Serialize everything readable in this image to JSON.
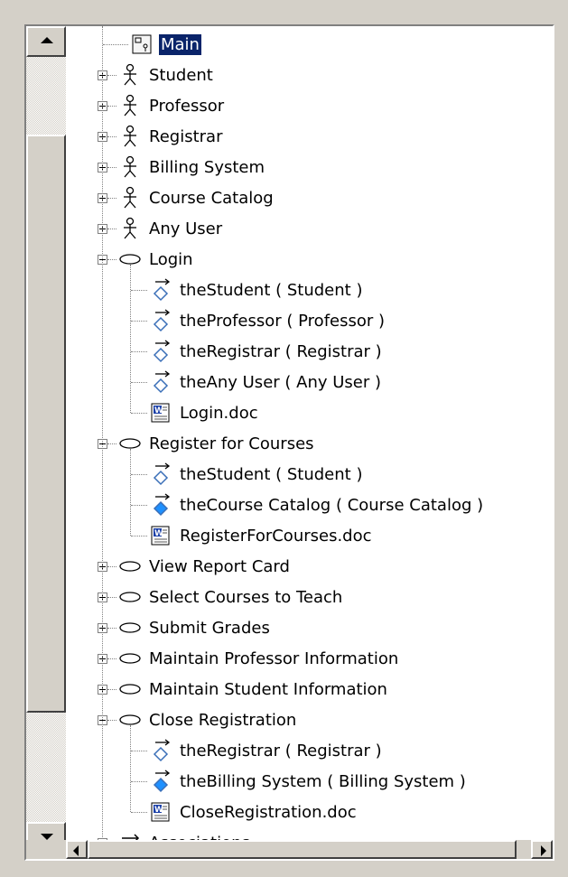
{
  "tree": {
    "root": {
      "label": "Main",
      "icon": "diagram-icon"
    },
    "actors": [
      {
        "label": "Student",
        "icon": "actor-icon"
      },
      {
        "label": "Professor",
        "icon": "actor-icon"
      },
      {
        "label": "Registrar",
        "icon": "actor-icon"
      },
      {
        "label": "Billing System",
        "icon": "actor-icon"
      },
      {
        "label": "Course Catalog",
        "icon": "actor-icon"
      },
      {
        "label": "Any User",
        "icon": "actor-icon"
      }
    ],
    "usecases": [
      {
        "label": "Login",
        "expanded": true,
        "children": [
          {
            "label": "theStudent ( Student )",
            "icon": "association-icon"
          },
          {
            "label": "theProfessor ( Professor )",
            "icon": "association-icon"
          },
          {
            "label": "theRegistrar ( Registrar )",
            "icon": "association-icon"
          },
          {
            "label": "theAny User ( Any User )",
            "icon": "association-icon"
          },
          {
            "label": "Login.doc",
            "icon": "document-icon"
          }
        ]
      },
      {
        "label": "Register for Courses",
        "expanded": true,
        "children": [
          {
            "label": "theStudent ( Student )",
            "icon": "association-icon"
          },
          {
            "label": "theCourse Catalog ( Course Catalog )",
            "icon": "association-filled-icon"
          },
          {
            "label": "RegisterForCourses.doc",
            "icon": "document-icon"
          }
        ]
      },
      {
        "label": "View Report Card",
        "expanded": false,
        "children": []
      },
      {
        "label": "Select Courses to Teach",
        "expanded": false,
        "children": []
      },
      {
        "label": "Submit Grades",
        "expanded": false,
        "children": []
      },
      {
        "label": "Maintain Professor Information",
        "expanded": false,
        "children": []
      },
      {
        "label": "Maintain Student Information",
        "expanded": false,
        "children": []
      },
      {
        "label": "Close Registration",
        "expanded": true,
        "children": [
          {
            "label": "theRegistrar ( Registrar )",
            "icon": "association-icon"
          },
          {
            "label": "theBilling System ( Billing System )",
            "icon": "association-filled-icon"
          },
          {
            "label": "CloseRegistration.doc",
            "icon": "document-icon"
          }
        ]
      }
    ],
    "associations": {
      "label": "Associations",
      "icon": "association-arrows-icon"
    }
  },
  "colors": {
    "selection": "#0a246a",
    "chrome": "#d4d0c8"
  }
}
